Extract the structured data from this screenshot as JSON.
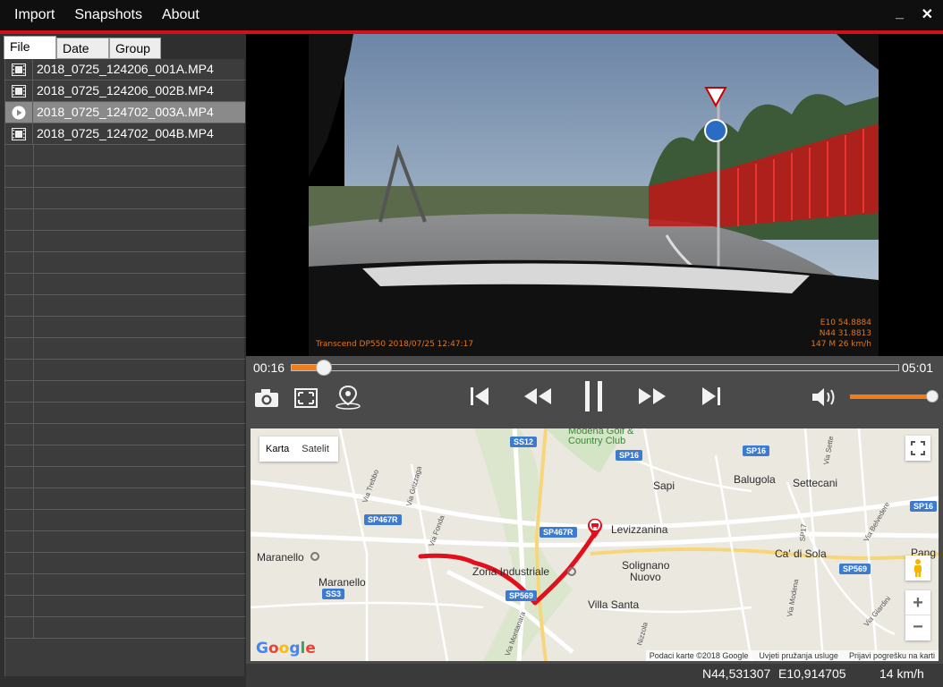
{
  "menu": {
    "import": "Import",
    "snapshots": "Snapshots",
    "about": "About"
  },
  "window": {
    "minimize": "_",
    "close": "✕"
  },
  "tabs": {
    "file": "File",
    "date": "Date",
    "group": "Group"
  },
  "files": [
    {
      "name": "2018_0725_124206_001A.MP4",
      "icon": "film-icon"
    },
    {
      "name": "2018_0725_124206_002B.MP4",
      "icon": "film-icon"
    },
    {
      "name": "2018_0725_124702_003A.MP4",
      "icon": "play-icon",
      "selected": true
    },
    {
      "name": "2018_0725_124702_004B.MP4",
      "icon": "film-icon"
    }
  ],
  "empty_rows": 23,
  "video_osd": {
    "stamp": "Transcend DP550 2018/07/25 12:47:17",
    "lon": "E10 54.8884",
    "lat": "N44 31.8813",
    "alt_speed": "147 M   26 km/h"
  },
  "player": {
    "elapsed": "00:16",
    "duration": "05:01",
    "progress": 0.053,
    "volume": 1.0
  },
  "map": {
    "type_map": "Karta",
    "type_sat": "Satelit",
    "attribution": [
      "Podaci karte ©2018 Google",
      "Uvjeti pružanja usluge",
      "Prijavi pogrešku na karti"
    ],
    "logo": "Google",
    "zoom_in": "+",
    "zoom_out": "−",
    "places": {
      "maranello_poi": "Maranello",
      "maranello": "Maranello",
      "modena_golf_1": "Modena Golf &",
      "modena_golf_2": "Country Club",
      "sapi": "Sapi",
      "balugola": "Balugola",
      "settecani": "Settecani",
      "levizzanina": "Levizzanina",
      "zona": "Zona Industriale",
      "solignano_1": "Solignano",
      "solignano_2": "Nuovo",
      "villa_santa": "Villa Santa",
      "cadisola": "Ca' di Sola",
      "pang": "Pang"
    },
    "shields": {
      "ss12": "SS12",
      "sp16a": "SP16",
      "sp16b": "SP16",
      "sp16c": "SP16",
      "sp467a": "SP467R",
      "sp467b": "SP467R",
      "sp569a": "SP569",
      "sp569b": "SP569",
      "ss3": "SS3"
    },
    "roads": {
      "trebbo": "Via Trebbo",
      "grizzaga": "Via Grizzaga",
      "fonda": "Via Fonda",
      "montanara": "Via Montanara",
      "modena": "Via Modena",
      "settecani": "Via Sette",
      "p17": "SP17",
      "nizzola": "Nizzola",
      "belvedere": "Via Belvedere",
      "giardini": "Via Giardini"
    }
  },
  "status": {
    "lat": "N44,531307",
    "lon": "E10,914705",
    "speed": "14 km/h"
  },
  "colors": {
    "accent": "#f07c1a",
    "brand_red": "#d3101a",
    "route": "#e0101c"
  }
}
